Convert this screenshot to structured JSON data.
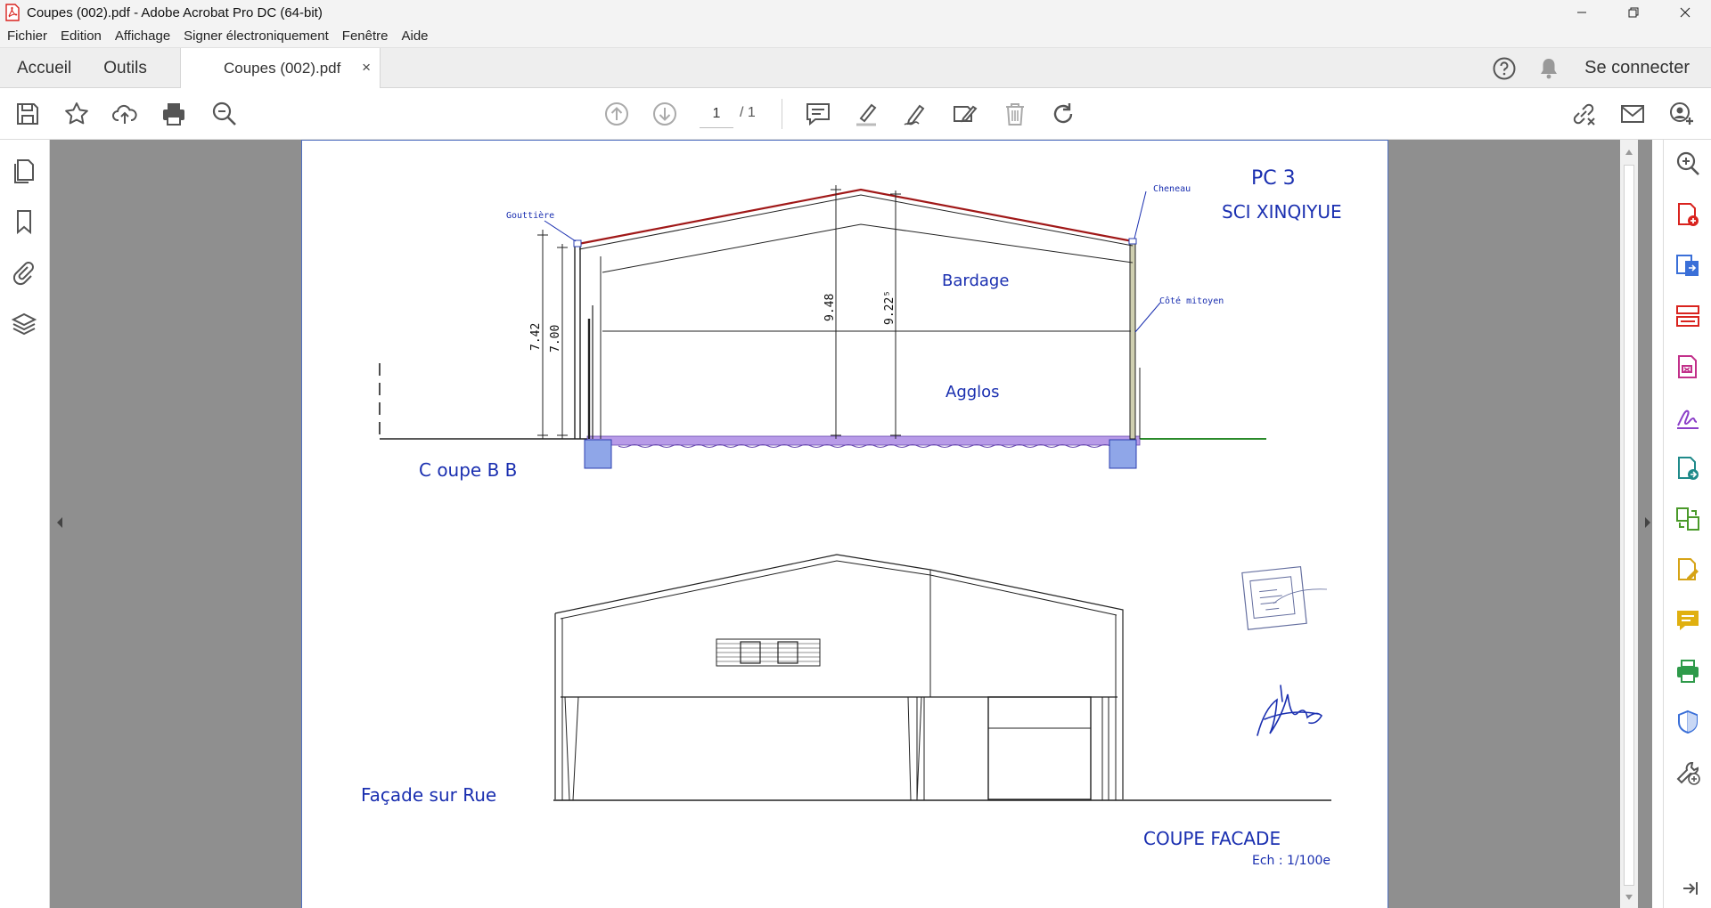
{
  "window": {
    "title": "Coupes (002).pdf - Adobe Acrobat Pro DC (64-bit)",
    "controls": {
      "minimize": "—",
      "restore": "❐",
      "close": "✕"
    }
  },
  "menu": [
    "Fichier",
    "Edition",
    "Affichage",
    "Signer électroniquement",
    "Fenêtre",
    "Aide"
  ],
  "tabs": {
    "home": "Accueil",
    "tools": "Outils",
    "document": "Coupes (002).pdf",
    "close": "×",
    "signin": "Se connecter"
  },
  "pagination": {
    "current": "1",
    "total": "/ 1"
  },
  "drawing": {
    "pc_label": "PC 3",
    "company": "SCI XINQIYUE",
    "gutter_label": "Gouttière",
    "cheneau_label": "Cheneau",
    "mitoyen_label": "Côté mitoyen",
    "bardage_label": "Bardage",
    "agglos_label": "Agglos",
    "dim_742": "7.42",
    "dim_700": "7.00",
    "dim_948": "9.48",
    "dim_9225": "9.22⁵",
    "section_label": "C oupe B B",
    "facade_label": "Façade sur Rue",
    "coupe_facade": "COUPE  FACADE",
    "scale": "Ech :  1/100e"
  },
  "colors": {
    "accent_blue": "#1a2fb0",
    "roof_red": "#a01818",
    "ground_green": "#2a8a2a",
    "foundation_purple": "#b89be8",
    "acrobat_red": "#d9231e"
  }
}
